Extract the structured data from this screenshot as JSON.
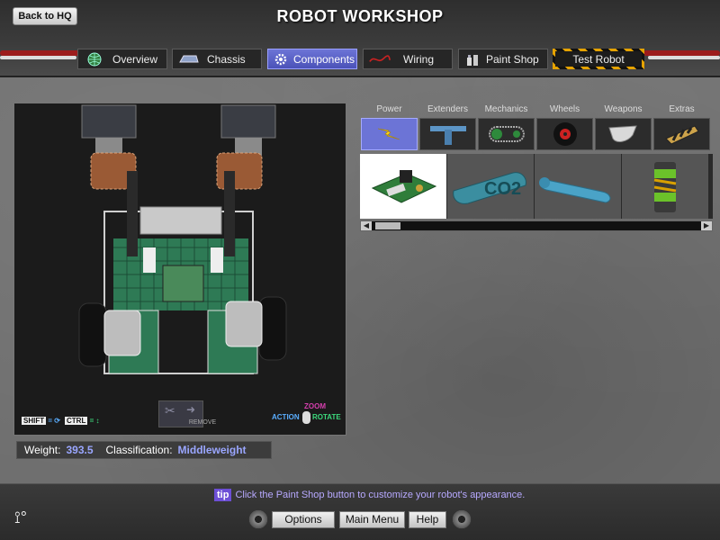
{
  "header": {
    "back_label": "Back to HQ",
    "title": "ROBOT WORKSHOP"
  },
  "nav": {
    "tabs": [
      {
        "label": "Overview",
        "icon": "globe-icon"
      },
      {
        "label": "Chassis",
        "icon": "chassis-icon"
      },
      {
        "label": "Components",
        "icon": "gear-icon",
        "active": true
      },
      {
        "label": "Wiring",
        "icon": "wire-icon"
      },
      {
        "label": "Paint Shop",
        "icon": "paint-icon"
      },
      {
        "label": "Test Robot",
        "icon": ""
      }
    ]
  },
  "viewport": {
    "remove_label": "REMOVE",
    "shift_key": "SHIFT",
    "ctrl_key": "CTRL",
    "action_label": "ACTION",
    "zoom_label": "ZOOM",
    "rotate_label": "ROTATE"
  },
  "stats": {
    "weight_label": "Weight:",
    "weight_value": "393.5",
    "class_label": "Classification:",
    "class_value": "Middleweight"
  },
  "components": {
    "categories": [
      {
        "label": "Power",
        "icon": "lightning-icon",
        "active": true
      },
      {
        "label": "Extenders",
        "icon": "t-bar-icon"
      },
      {
        "label": "Mechanics",
        "icon": "chain-icon"
      },
      {
        "label": "Wheels",
        "icon": "wheel-icon"
      },
      {
        "label": "Weapons",
        "icon": "plow-icon"
      },
      {
        "label": "Extras",
        "icon": "armor-plate-icon"
      }
    ],
    "items": [
      {
        "name": "circuit-board",
        "selected": true
      },
      {
        "name": "co2-tank"
      },
      {
        "name": "blue-cylinder"
      },
      {
        "name": "battery-pack"
      }
    ]
  },
  "footer": {
    "tip_badge": "tip",
    "tip_text": "Click the Paint Shop button to customize your robot's appearance.",
    "options_label": "Options",
    "main_menu_label": "Main Menu",
    "help_label": "Help"
  },
  "colors": {
    "accent": "#6c74d6",
    "value_text": "#9aa6ff",
    "tip_text": "#b7a9ff"
  }
}
